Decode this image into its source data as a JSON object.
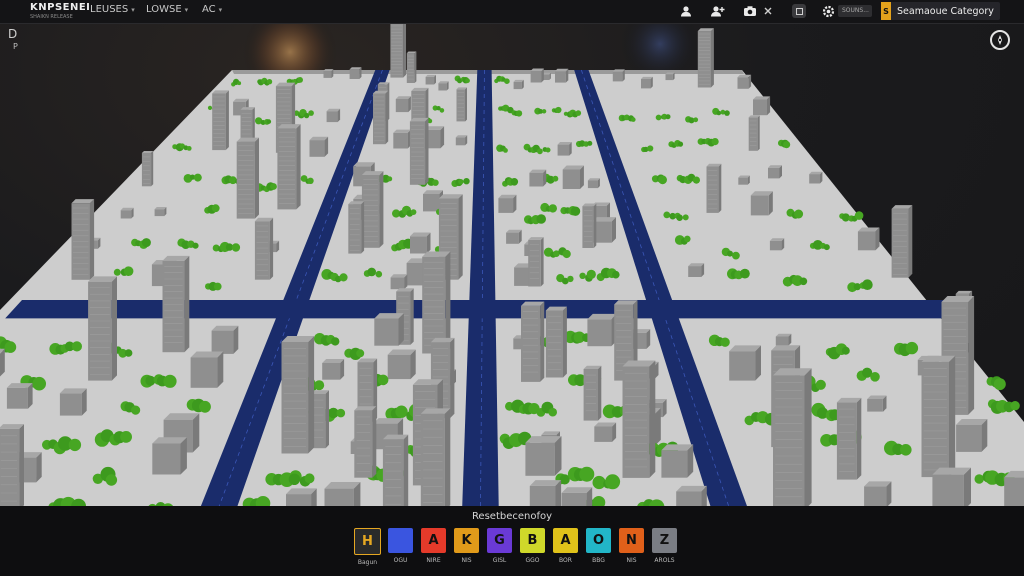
{
  "topbar": {
    "brand_name": "KNPSENEI",
    "brand_sub": "SHAIKN RELEASE",
    "menus": [
      {
        "label": "LEUSES",
        "icon": "chevron-down-icon"
      },
      {
        "label": "LOWSE",
        "icon": "chevron-down-icon"
      },
      {
        "label": "AC",
        "icon": "chevron-down-icon"
      }
    ],
    "right_icons": [
      "user-icon",
      "user-add-icon",
      "camera-icon",
      "close-icon",
      "settings-icon"
    ],
    "search_placeholder": "SOUNS...",
    "category_badge": "S",
    "category_label": "Seamaoue Category"
  },
  "corner": {
    "top_left_glyph": "D",
    "top_left_sub": "P",
    "top_right_icon": "compass-icon"
  },
  "toolbar": {
    "title": "Resetbecenofoy",
    "tools": [
      {
        "label": "Bagun",
        "color": "#2a2a2a",
        "glyph": "H",
        "icon": "build-icon"
      },
      {
        "label": "OGU",
        "color": "#3a55e0",
        "glyph": "",
        "icon": "water-icon"
      },
      {
        "label": "NIRE",
        "color": "#e53a2a",
        "glyph": "A",
        "icon": "fire-icon"
      },
      {
        "label": "NIS",
        "color": "#e09a1a",
        "glyph": "K",
        "icon": "person-icon"
      },
      {
        "label": "GISL",
        "color": "#6a3ad6",
        "glyph": "G",
        "icon": "gift-icon"
      },
      {
        "label": "GGO",
        "color": "#cfd82a",
        "glyph": "B",
        "icon": "badge-icon"
      },
      {
        "label": "BOR",
        "color": "#e0c21a",
        "glyph": "A",
        "icon": "agent-icon"
      },
      {
        "label": "BBG",
        "color": "#22b6c8",
        "glyph": "O",
        "icon": "chat-icon"
      },
      {
        "label": "NIS",
        "color": "#e0601a",
        "glyph": "N",
        "icon": "tool-icon"
      },
      {
        "label": "AROLS",
        "color": "#7a7d84",
        "glyph": "Z",
        "icon": "settings-icon"
      }
    ]
  },
  "colors": {
    "road": "#1a2c6b",
    "ground": "#cfcfcf",
    "tree": "#47a623",
    "building": "#a7a7a7"
  }
}
